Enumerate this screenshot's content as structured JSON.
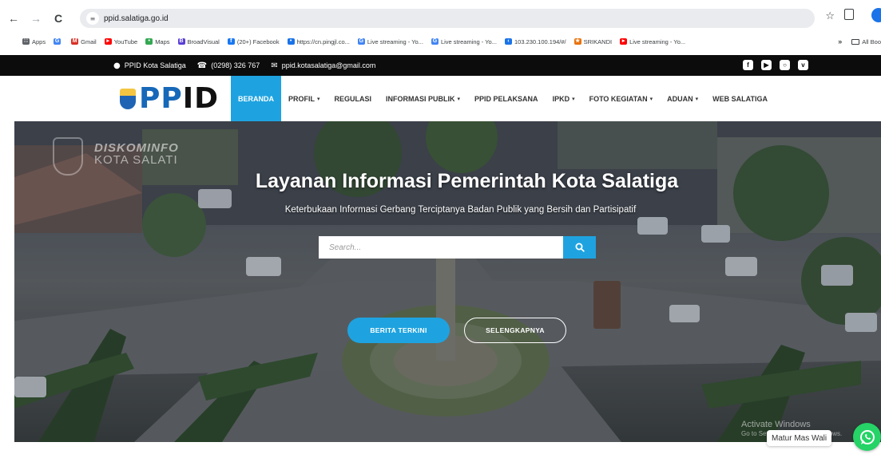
{
  "browser": {
    "url": "ppid.salatiga.go.id",
    "back_icon": "←",
    "forward_icon": "→",
    "reload_icon": "C",
    "site_info_icon": "≡",
    "star_icon": "☆",
    "extensions_icon": "⊕",
    "bookmarks": [
      {
        "label": "Apps",
        "icon": "apps-grid-icon",
        "color": "#5f6368",
        "glyph": "∷"
      },
      {
        "label": "",
        "icon": "google-icon",
        "color": "#4285f4",
        "glyph": "G"
      },
      {
        "label": "Gmail",
        "icon": "gmail-icon",
        "color": "#d93025",
        "glyph": "M"
      },
      {
        "label": "YouTube",
        "icon": "youtube-icon",
        "color": "#ff0000",
        "glyph": "▸"
      },
      {
        "label": "Maps",
        "icon": "maps-icon",
        "color": "#34a853",
        "glyph": "•"
      },
      {
        "label": "BroadVisual",
        "icon": "broadvisual-icon",
        "color": "#5b3ed6",
        "glyph": "B"
      },
      {
        "label": "(20+) Facebook",
        "icon": "facebook-icon",
        "color": "#1877f2",
        "glyph": "f"
      },
      {
        "label": "https://cn.pingjl.co...",
        "icon": "link-icon",
        "color": "#1a73e8",
        "glyph": "•"
      },
      {
        "label": "Live streaming - Yo...",
        "icon": "google-icon",
        "color": "#4285f4",
        "glyph": "G"
      },
      {
        "label": "Live streaming - Yo...",
        "icon": "google-icon",
        "color": "#4285f4",
        "glyph": "G"
      },
      {
        "label": "103.230.100.194/#/",
        "icon": "globe-icon",
        "color": "#1a73e8",
        "glyph": "‹"
      },
      {
        "label": "SRIKANDI",
        "icon": "srikandi-icon",
        "color": "#e8710a",
        "glyph": "★"
      },
      {
        "label": "Live streaming - Yo...",
        "icon": "youtube-icon",
        "color": "#ff0000",
        "glyph": "▸"
      }
    ],
    "more_bookmarks": "»",
    "all_bookmarks": "All Boo"
  },
  "topbar": {
    "org": "PPID Kota Salatiga",
    "phone": "(0298) 326 767",
    "email": "ppid.kotasalatiga@gmail.com",
    "social": [
      {
        "icon": "facebook-icon",
        "glyph": "f"
      },
      {
        "icon": "youtube-icon",
        "glyph": "▶"
      },
      {
        "icon": "instagram-icon",
        "glyph": "○"
      },
      {
        "icon": "vimeo-icon",
        "glyph": "v"
      }
    ]
  },
  "header": {
    "logo_text": "PPID",
    "nav": [
      {
        "label": "BERANDA",
        "active": true,
        "dropdown": false
      },
      {
        "label": "PROFIL",
        "active": false,
        "dropdown": true
      },
      {
        "label": "REGULASI",
        "active": false,
        "dropdown": false
      },
      {
        "label": "INFORMASI PUBLIK",
        "active": false,
        "dropdown": true
      },
      {
        "label": "PPID PELAKSANA",
        "active": false,
        "dropdown": false
      },
      {
        "label": "IPKD",
        "active": false,
        "dropdown": true
      },
      {
        "label": "FOTO KEGIATAN",
        "active": false,
        "dropdown": true
      },
      {
        "label": "ADUAN",
        "active": false,
        "dropdown": true
      },
      {
        "label": "WEB SALATIGA",
        "active": false,
        "dropdown": false
      }
    ]
  },
  "hero": {
    "watermark_line1": "DISKOMINFO",
    "watermark_line2": "KOTA SALATI",
    "title": "Layanan Informasi Pemerintah Kota Salatiga",
    "subtitle": "Keterbukaan Informasi Gerbang Terciptanya Badan Publik yang Bersih dan Partisipatif",
    "search_placeholder": "Search...",
    "btn_primary": "BERITA TERKINI",
    "btn_secondary": "SELENGKAPNYA",
    "activate_line1": "Activate Windows",
    "activate_line2": "Go to Settings to activate Windows."
  },
  "chat": {
    "label": "Matur Mas Wali"
  },
  "colors": {
    "accent": "#1ea3e0",
    "topbar_bg": "#0c0c0c",
    "whatsapp": "#25d366"
  }
}
